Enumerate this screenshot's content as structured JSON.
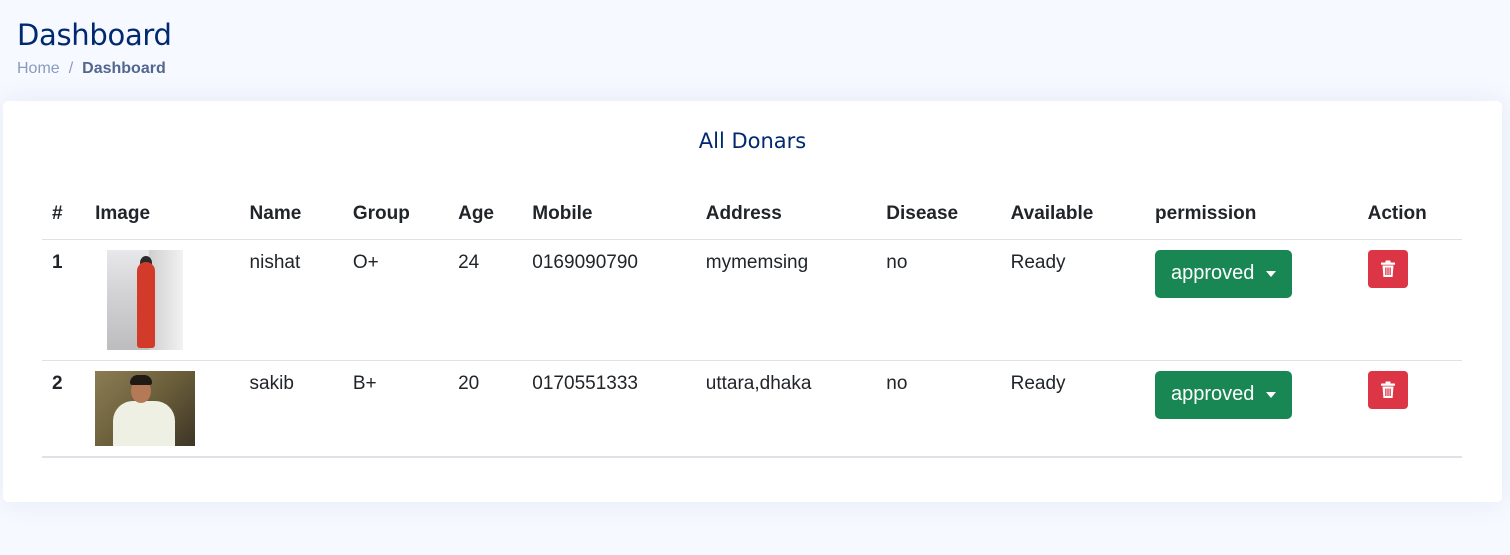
{
  "page": {
    "title": "Dashboard",
    "breadcrumb": [
      "Home",
      "Dashboard"
    ],
    "breadcrumb_separator": "/"
  },
  "card": {
    "title": "All Donars"
  },
  "table": {
    "columns": [
      "#",
      "Image",
      "Name",
      "Group",
      "Age",
      "Mobile",
      "Address",
      "Disease",
      "Available",
      "permission",
      "Action"
    ],
    "rows": [
      {
        "num": "1",
        "image": "donor-photo-nishat",
        "name": "nishat",
        "group": "O+",
        "age": "24",
        "mobile": "0169090790",
        "address": "mymemsing",
        "disease": "no",
        "available": "Ready",
        "permission": "approved",
        "action_icon": "trash-icon"
      },
      {
        "num": "2",
        "image": "donor-photo-sakib",
        "name": "sakib",
        "group": "B+",
        "age": "20",
        "mobile": "0170551333",
        "address": "uttara,dhaka",
        "disease": "no",
        "available": "Ready",
        "permission": "approved",
        "action_icon": "trash-icon"
      }
    ]
  },
  "colors": {
    "title": "#012970",
    "approved_button": "#198754",
    "delete_button": "#dc3545",
    "page_background": "#f6f9ff"
  }
}
